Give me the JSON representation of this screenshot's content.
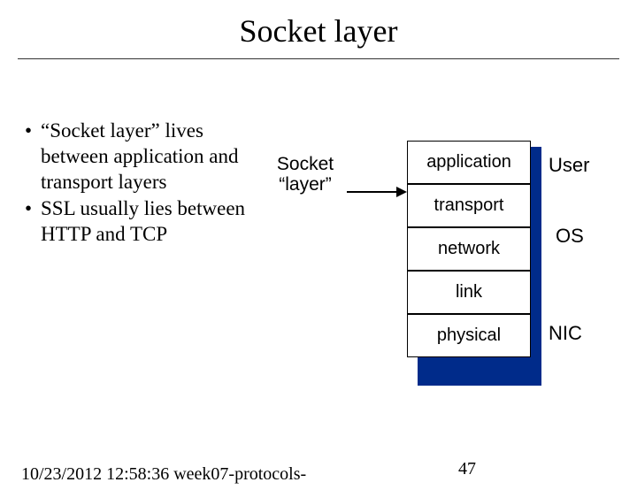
{
  "title": "Socket layer",
  "bullets": [
    "“Socket layer” lives between application and transport layers",
    "SSL usually lies between HTTP and TCP"
  ],
  "socket_label": {
    "line1": "Socket",
    "line2": "“layer”"
  },
  "stack": {
    "application": "application",
    "transport": "transport",
    "network": "network",
    "link": "link",
    "physical": "physical"
  },
  "os_labels": {
    "user": "User",
    "os": "OS",
    "nic": "NIC"
  },
  "footer": {
    "date": "10/23/2012 12:58:36",
    "file": "week07-protocols-",
    "page": "47"
  }
}
